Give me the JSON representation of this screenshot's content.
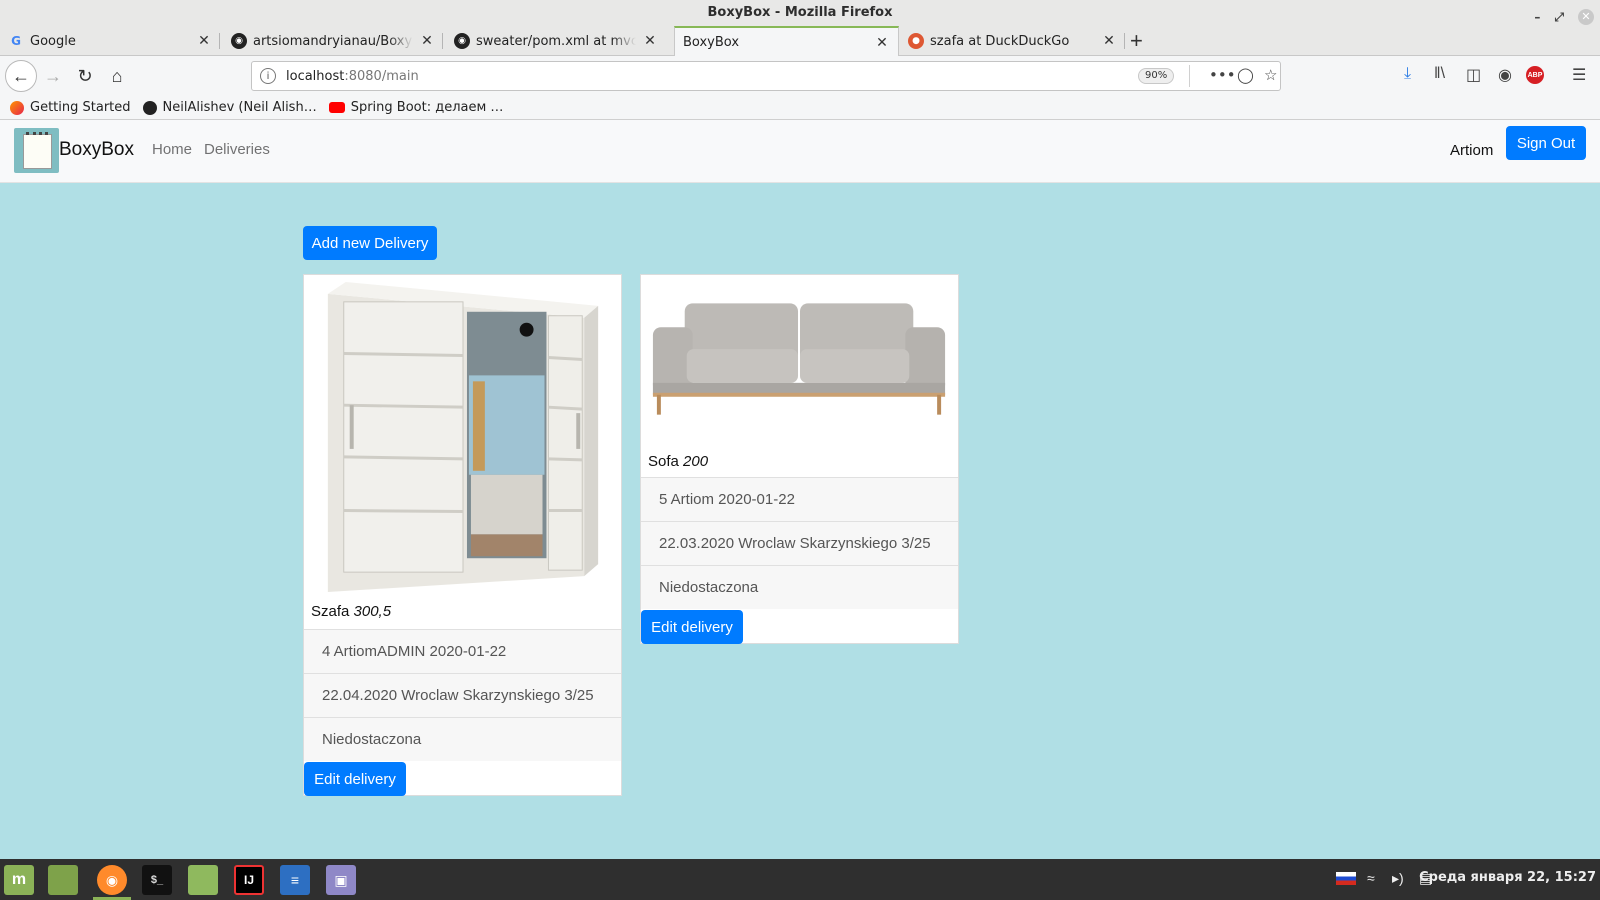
{
  "window": {
    "title": "BoxyBox - Mozilla Firefox"
  },
  "tabs": [
    {
      "title": "Google",
      "icon": "google-icon"
    },
    {
      "title": "artsiomandryianau/BoxyBox",
      "icon": "github-icon"
    },
    {
      "title": "sweater/pom.xml at mvc-web",
      "icon": "github-icon"
    },
    {
      "title": "BoxyBox",
      "icon": "page-icon",
      "active": true
    },
    {
      "title": "szafa at DuckDuckGo",
      "icon": "duckduckgo-icon"
    }
  ],
  "url": {
    "host": "localhost",
    "path": ":8080/main",
    "zoom": "90%"
  },
  "bookmarks": [
    {
      "label": "Getting Started",
      "icon": "firefox-icon"
    },
    {
      "label": "NeilAlishev (Neil Alish…",
      "icon": "github-icon"
    },
    {
      "label": "Spring Boot: делаем …",
      "icon": "youtube-icon"
    }
  ],
  "app": {
    "brand": "BoxyBox",
    "nav": {
      "home": "Home",
      "deliveries": "Deliveries"
    },
    "user": "Artiom",
    "sign_out": "Sign Out",
    "add_delivery": "Add new Delivery",
    "accent": "#007bff"
  },
  "deliveries": [
    {
      "name": "Szafa",
      "price": "300,5",
      "image": "wardrobe-image",
      "details": [
        "4 ArtiomADMIN 2020-01-22",
        "22.04.2020 Wroclaw Skarzynskiego 3/25",
        "Niedostaczona"
      ],
      "edit": "Edit delivery"
    },
    {
      "name": "Sofa",
      "price": "200",
      "image": "sofa-image",
      "details": [
        "5 Artiom 2020-01-22",
        "22.03.2020 Wroclaw Skarzynskiego 3/25",
        "Niedostaczona"
      ],
      "edit": "Edit delivery"
    }
  ],
  "taskbar": {
    "clock": "Среда января 22, 15:27"
  }
}
